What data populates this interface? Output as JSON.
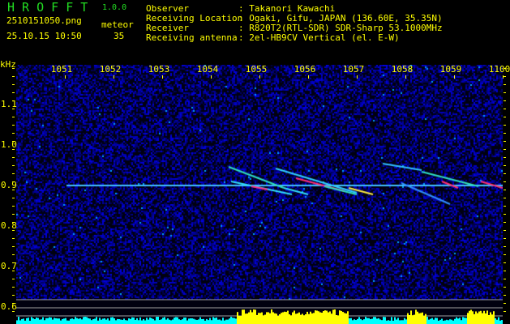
{
  "app": {
    "name": "H R O F F T",
    "version": "1.0.0"
  },
  "file": {
    "name": "2510151050.png",
    "datetime": "25.10.15 10:50"
  },
  "detection": {
    "label": "meteor",
    "count": "35"
  },
  "info": [
    {
      "label": "Observer",
      "value": ": Takanori Kawachi"
    },
    {
      "label": "Receiving Location",
      "value": ": Ogaki, Gifu, JAPAN (136.60E, 35.35N)"
    },
    {
      "label": "Receiver",
      "value": ": R820T2(RTL-SDR) SDR-Sharp 53.1000MHz"
    },
    {
      "label": "Receiving antenna",
      "value": ": 2el-HB9CV Vertical (el. E-W)"
    }
  ],
  "y_axis": {
    "unit": "kHz",
    "ticks": [
      "1.1",
      "1.0",
      "0.9",
      "0.8",
      "0.7",
      "0.6"
    ]
  },
  "x_axis": {
    "ticks": [
      "1051",
      "1052",
      "1053",
      "1054",
      "1055",
      "1056",
      "1057",
      "1058",
      "1059",
      "1100"
    ]
  },
  "colors": {
    "text": "#ffff00",
    "title": "#22dd22",
    "histogram": "#00ffff",
    "histogram_peak": "#ffff00",
    "reference_lines": "#a0a0a0"
  }
}
